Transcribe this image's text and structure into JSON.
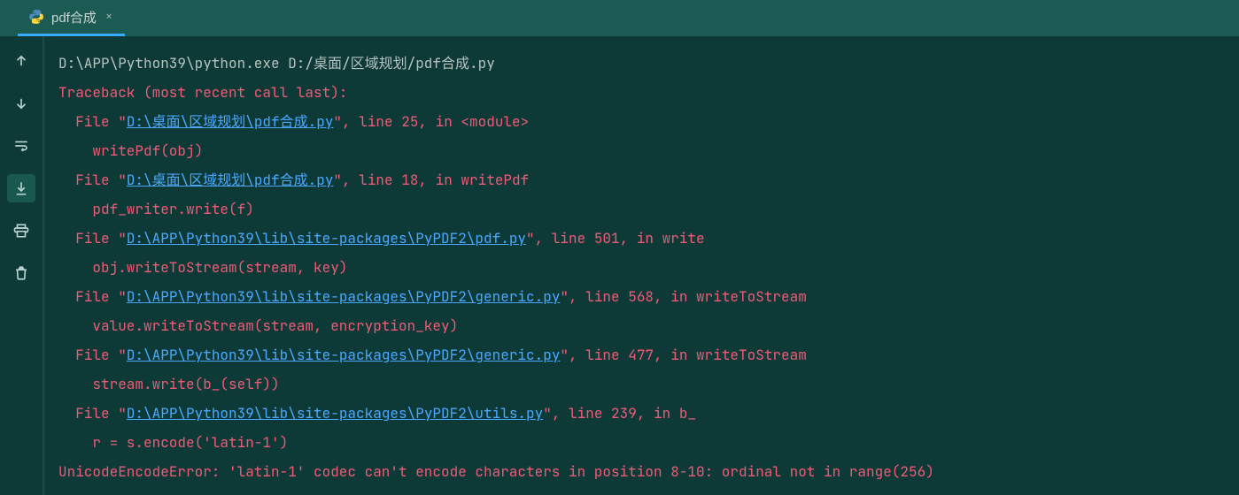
{
  "tab": {
    "label": "pdf合成",
    "close_glyph": "×"
  },
  "gutter": {
    "up": "up-arrow-icon",
    "down": "down-arrow-icon",
    "wrap": "soft-wrap-icon",
    "scroll_end": "scroll-to-end-icon",
    "print": "print-icon",
    "trash": "trash-icon"
  },
  "console": {
    "cmd": "D:\\APP\\Python39\\python.exe D:/桌面/区域规划/pdf合成.py",
    "traceback_header": "Traceback (most recent call last):",
    "frames": [
      {
        "prefix": "  File \"",
        "path": "D:\\桌面\\区域规划\\pdf合成.py",
        "suffix": "\", line 25, in <module>",
        "code": "    writePdf(obj)"
      },
      {
        "prefix": "  File \"",
        "path": "D:\\桌面\\区域规划\\pdf合成.py",
        "suffix": "\", line 18, in writePdf",
        "code": "    pdf_writer.write(f)"
      },
      {
        "prefix": "  File \"",
        "path": "D:\\APP\\Python39\\lib\\site-packages\\PyPDF2\\pdf.py",
        "suffix": "\", line 501, in write",
        "code": "    obj.writeToStream(stream, key)"
      },
      {
        "prefix": "  File \"",
        "path": "D:\\APP\\Python39\\lib\\site-packages\\PyPDF2\\generic.py",
        "suffix": "\", line 568, in writeToStream",
        "code": "    value.writeToStream(stream, encryption_key)"
      },
      {
        "prefix": "  File \"",
        "path": "D:\\APP\\Python39\\lib\\site-packages\\PyPDF2\\generic.py",
        "suffix": "\", line 477, in writeToStream",
        "code": "    stream.write(b_(self))"
      },
      {
        "prefix": "  File \"",
        "path": "D:\\APP\\Python39\\lib\\site-packages\\PyPDF2\\utils.py",
        "suffix": "\", line 239, in b_",
        "code": "    r = s.encode('latin-1')"
      }
    ],
    "error": "UnicodeEncodeError: 'latin-1' codec can't encode characters in position 8-10: ordinal not in range(256)"
  }
}
